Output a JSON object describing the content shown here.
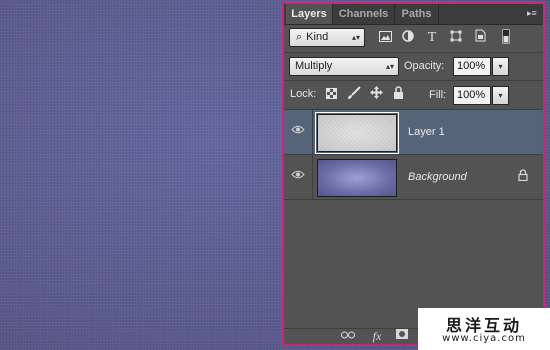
{
  "tabs": [
    {
      "label": "Layers",
      "active": true
    },
    {
      "label": "Channels",
      "active": false
    },
    {
      "label": "Paths",
      "active": false
    }
  ],
  "filter": {
    "kind_label": "Kind",
    "icons": [
      "image-filter-icon",
      "adjustment-filter-icon",
      "type-filter-icon",
      "shape-filter-icon",
      "smart-object-filter-icon",
      "filter-toggle-icon"
    ]
  },
  "blend": {
    "mode": "Multiply",
    "opacity_label": "Opacity:",
    "opacity_value": "100%"
  },
  "lock": {
    "label": "Lock:",
    "icons": [
      "lock-transparent-icon",
      "lock-pixels-icon",
      "lock-position-icon",
      "lock-all-icon"
    ],
    "fill_label": "Fill:",
    "fill_value": "100%"
  },
  "layers": [
    {
      "name": "Layer 1",
      "selected": true,
      "visible": true,
      "locked": false
    },
    {
      "name": "Background",
      "selected": false,
      "visible": true,
      "locked": true
    }
  ],
  "footer_icons": [
    "link-icon",
    "fx-icon",
    "mask-icon"
  ],
  "footer_fx_label": "fx",
  "watermark": {
    "line1": "思洋互动",
    "line2": "www.ciya.com"
  },
  "colors": {
    "panel_border": "#c8267a",
    "selected_row": "#56647a",
    "canvas": "#5d5e90"
  }
}
